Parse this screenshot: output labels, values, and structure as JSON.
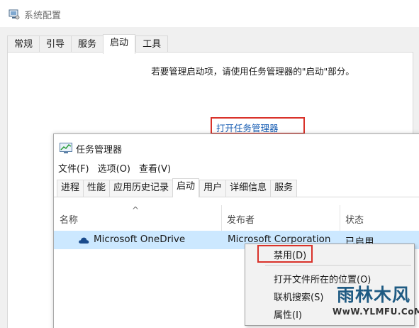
{
  "system_config": {
    "title": "系统配置",
    "tabs": [
      {
        "label": "常规"
      },
      {
        "label": "引导"
      },
      {
        "label": "服务"
      },
      {
        "label": "启动",
        "active": true
      },
      {
        "label": "工具"
      }
    ],
    "info_text": "若要管理启动项，请使用任务管理器的\"启动\"部分。",
    "open_task_manager_link": "打开任务管理器"
  },
  "task_manager": {
    "title": "任务管理器",
    "menu": [
      {
        "label": "文件(F)"
      },
      {
        "label": "选项(O)"
      },
      {
        "label": "查看(V)"
      }
    ],
    "tabs": [
      {
        "label": "进程"
      },
      {
        "label": "性能"
      },
      {
        "label": "应用历史记录"
      },
      {
        "label": "启动",
        "active": true
      },
      {
        "label": "用户"
      },
      {
        "label": "详细信息"
      },
      {
        "label": "服务"
      }
    ],
    "columns": {
      "name": "名称",
      "publisher": "发布者",
      "status": "状态"
    },
    "rows": [
      {
        "name": "Microsoft OneDrive",
        "publisher": "Microsoft Corporation",
        "status": "已启用",
        "icon": "onedrive-cloud-icon"
      }
    ]
  },
  "context_menu": {
    "items": [
      {
        "label": "禁用(D)",
        "highlighted": true
      },
      {
        "label": "打开文件所在的位置(O)"
      },
      {
        "label": "联机搜索(S)"
      },
      {
        "label": "属性(I)"
      }
    ]
  },
  "watermark": {
    "text": "雨林木风",
    "url": "WwW.YLMFU.CoM"
  },
  "colors": {
    "highlight_box": "#d9322a",
    "link": "#1a5fb4",
    "selected_row": "#cce8ff"
  }
}
